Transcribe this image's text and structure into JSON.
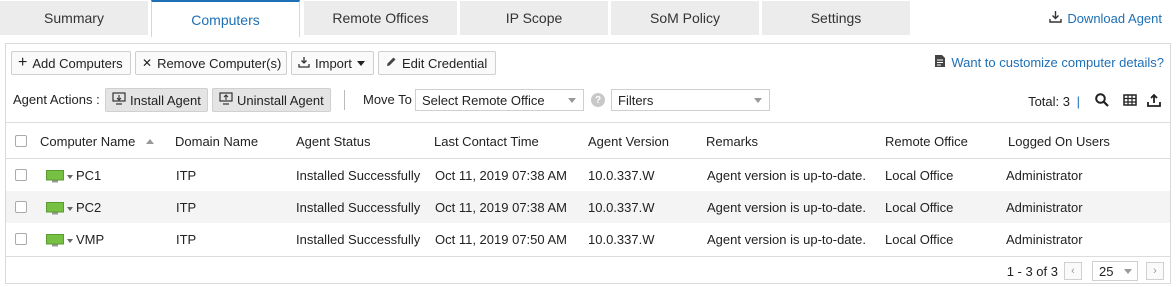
{
  "tabs": [
    "Summary",
    "Computers",
    "Remote Offices",
    "IP Scope",
    "SoM Policy",
    "Settings"
  ],
  "download_agent": "Download Agent",
  "toolbar": {
    "add": "Add Computers",
    "remove": "Remove Computer(s)",
    "import": "Import",
    "edit": "Edit Credential",
    "customize": "Want to customize computer details?"
  },
  "actions": {
    "label": "Agent Actions :",
    "install": "Install Agent",
    "uninstall": "Uninstall Agent",
    "move_to": "Move To",
    "remote_office": "Select Remote Office",
    "filters": "Filters",
    "total": "Total: 3",
    "total_sep": "|"
  },
  "columns": [
    "Computer Name",
    "Domain Name",
    "Agent Status",
    "Last Contact Time",
    "Agent Version",
    "Remarks",
    "Remote Office",
    "Logged On Users"
  ],
  "rows": [
    {
      "name": "PC1",
      "domain": "ITP",
      "status": "Installed Successfully",
      "contact": "Oct 11, 2019 07:38 AM",
      "version": "10.0.337.W",
      "remarks": "Agent version is up-to-date.",
      "office": "Local Office",
      "users": "Administrator"
    },
    {
      "name": "PC2",
      "domain": "ITP",
      "status": "Installed Successfully",
      "contact": "Oct 11, 2019 07:38 AM",
      "version": "10.0.337.W",
      "remarks": "Agent version is up-to-date.",
      "office": "Local Office",
      "users": "Administrator"
    },
    {
      "name": "VMP",
      "domain": "ITP",
      "status": "Installed Successfully",
      "contact": "Oct 11, 2019 07:50 AM",
      "version": "10.0.337.W",
      "remarks": "Agent version is up-to-date.",
      "office": "Local Office",
      "users": "Administrator"
    }
  ],
  "pager": {
    "range": "1 - 3 of 3",
    "page_size": "25"
  },
  "colors": {
    "accent": "#1e6fb5",
    "monitor": "#76c043"
  }
}
